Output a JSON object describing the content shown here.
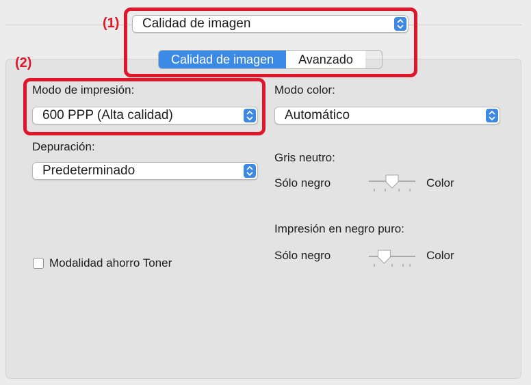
{
  "annotations": {
    "one": "(1)",
    "two": "(2)"
  },
  "top_popup": {
    "value": "Calidad de imagen"
  },
  "tabs": [
    {
      "label": "Calidad de imagen",
      "active": true
    },
    {
      "label": "Avanzado",
      "active": false
    }
  ],
  "left": {
    "print_mode": {
      "label": "Modo de impresión:",
      "value": "600 PPP (Alta calidad)"
    },
    "depuracion": {
      "label": "Depuración:",
      "value": "Predeterminado"
    },
    "toner_save": {
      "label": "Modalidad ahorro Toner",
      "checked": false
    }
  },
  "right": {
    "color_mode": {
      "label": "Modo color:",
      "value": "Automático"
    },
    "neutral_gray": {
      "label": "Gris neutro:",
      "left": "Sólo negro",
      "right": "Color",
      "level": 0.5
    },
    "pure_black": {
      "label": "Impresión en negro puro:",
      "left": "Sólo negro",
      "right": "Color",
      "level": 0.33
    }
  },
  "colors": {
    "accent": "#3b8ae5",
    "annotation": "#e0162b"
  }
}
